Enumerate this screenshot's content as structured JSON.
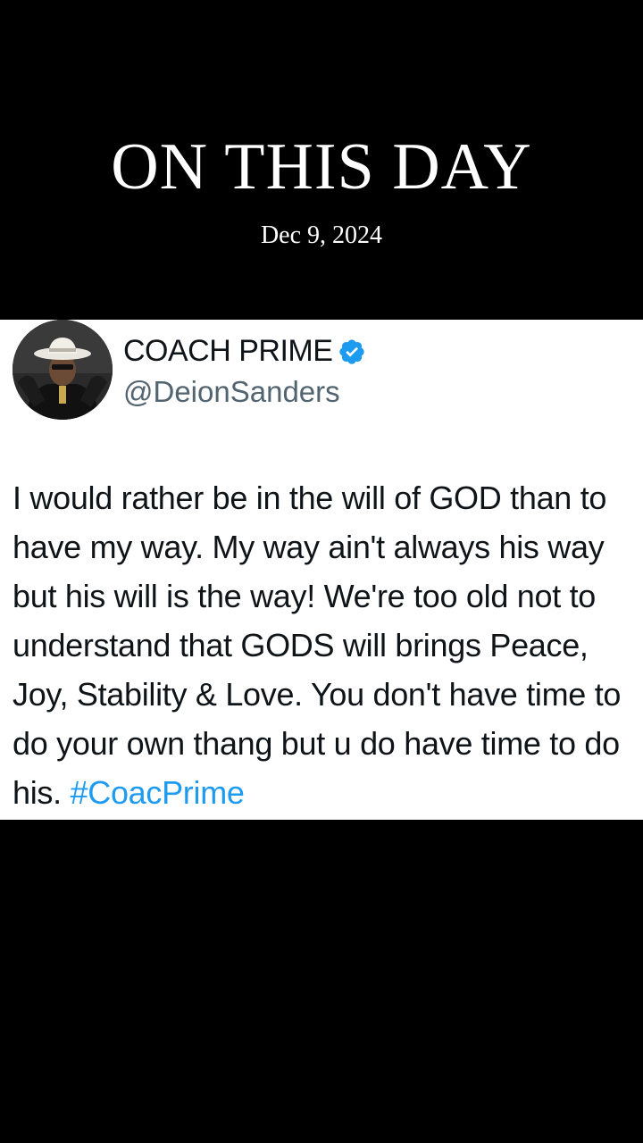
{
  "header": {
    "headline": "ON THIS DAY",
    "date": "Dec 9, 2024"
  },
  "profile": {
    "display_name": "COACH PRIME",
    "handle": "@DeionSanders",
    "verified": true,
    "avatar_icon": "profile-photo"
  },
  "tweet": {
    "text": "I would rather be in the will of GOD than to have my way. My way ain't always his way but his will is the way! We're too old not to understand that GODS will brings Peace, Joy, Stability & Love. You don't have time to do your own thang but u do have time to do his.",
    "hashtag": "#CoacPrime"
  },
  "colors": {
    "background": "#000000",
    "card": "#ffffff",
    "text": "#0f1419",
    "secondary_text": "#536471",
    "link": "#1d9bf0",
    "verified_badge": "#1d9bf0"
  }
}
